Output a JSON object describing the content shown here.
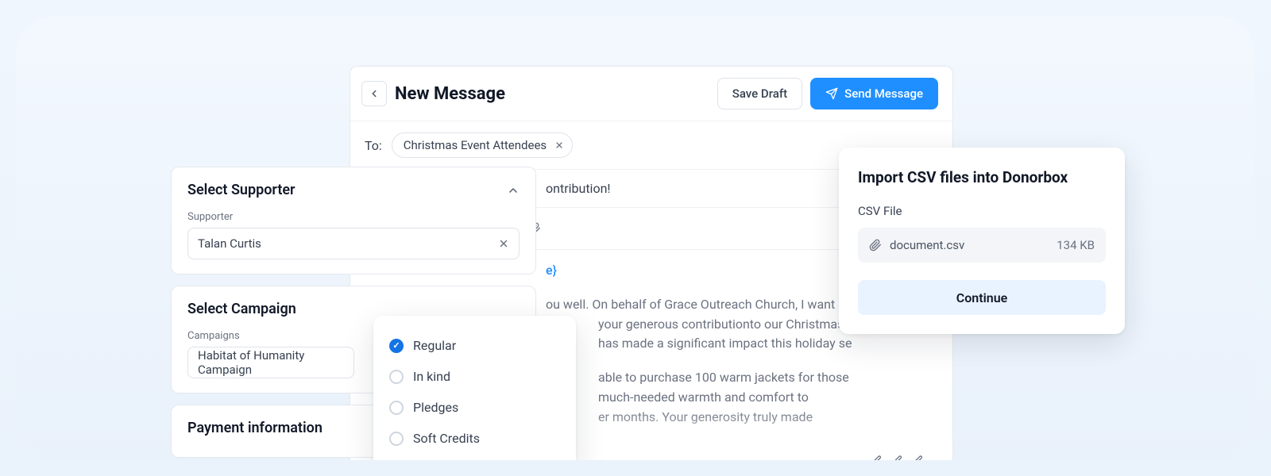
{
  "composer": {
    "title": "New Message",
    "save_draft_label": "Save Draft",
    "send_label": "Send Message",
    "to_label": "To:",
    "to_chip": "Christmas Event Attendees",
    "subject_fragment": "ontribution!",
    "placeholder_token_fragment": "e}",
    "body_p1": "ou well. On behalf of Grace Outreach Church, I want",
    "body_p2": "your generous contributionto our Christmas",
    "body_p3": "has made a significant impact this holiday se",
    "body_p4": "able to purchase 100 warm jackets for those",
    "body_p5": "much-needed warmth and comfort to",
    "body_p6": "er months. Your generosity truly made"
  },
  "supporter_card": {
    "title": "Select Supporter",
    "field_label": "Supporter",
    "value": "Talan Curtis"
  },
  "campaign_card": {
    "title": "Select Campaign",
    "field_label": "Campaigns",
    "value": "Habitat of Humanity Campaign"
  },
  "payment_card": {
    "title": "Payment information"
  },
  "type_options": {
    "opt1": "Regular",
    "opt2": "In kind",
    "opt3": "Pledges",
    "opt4": "Soft Credits"
  },
  "csv": {
    "title": "Import CSV files into Donorbox",
    "label": "CSV File",
    "filename": "document.csv",
    "filesize": "134 KB",
    "continue_label": "Continue"
  }
}
